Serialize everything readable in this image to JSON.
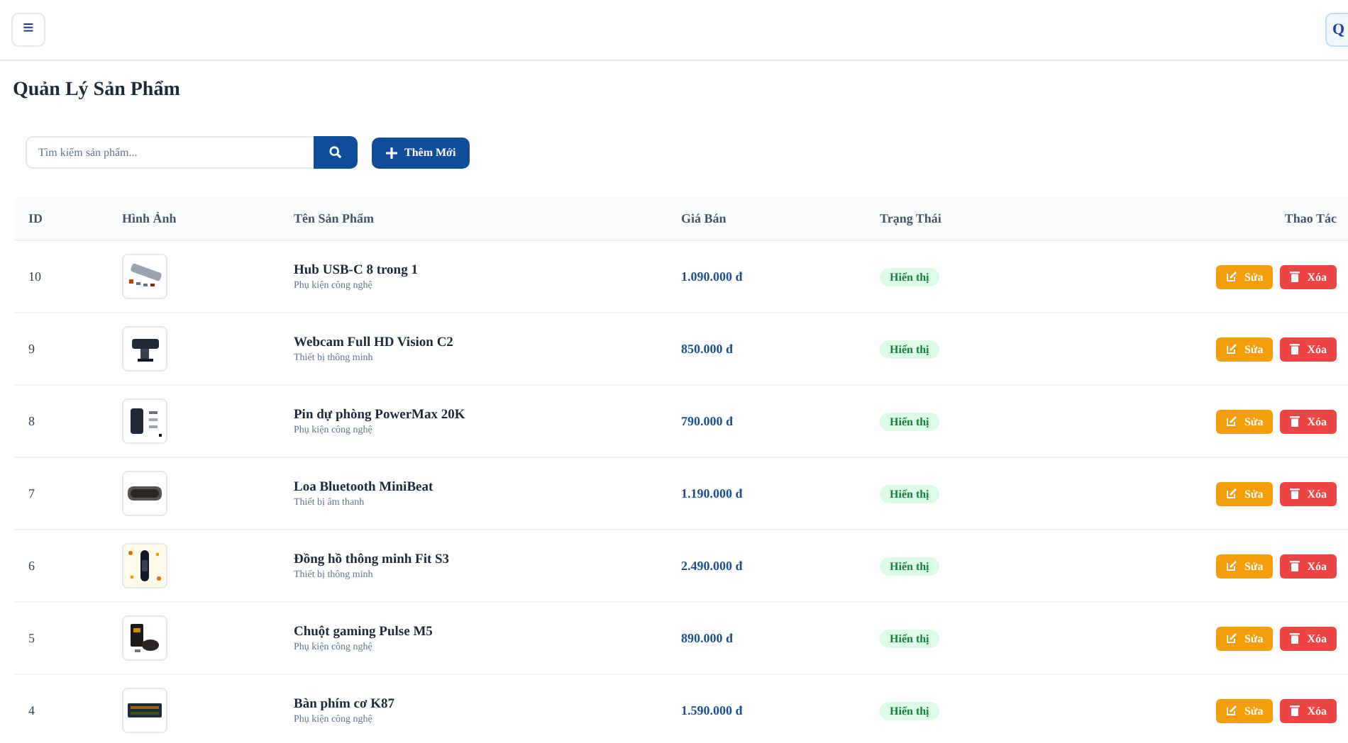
{
  "topbar": {
    "menu_icon": "≡",
    "account_button": "Q"
  },
  "page_title": "Quản Lý Sản Phẩm",
  "search": {
    "placeholder": "Tìm kiếm sản phẩm..."
  },
  "add_button": "Thêm Mới",
  "table": {
    "columns": [
      "ID",
      "Hình Ảnh",
      "Tên Sản Phẩm",
      "Giá Bán",
      "Trạng Thái",
      "Thao Tác"
    ],
    "rows": [
      {
        "id": "10",
        "name": "Hub USB-C 8 trong 1",
        "category": "Phụ kiện công nghệ",
        "price": "1.090.000 đ",
        "status": "Hiển thị",
        "edit": "Sửa",
        "delete": "Xóa"
      },
      {
        "id": "9",
        "name": "Webcam Full HD Vision C2",
        "category": "Thiết bị thông minh",
        "price": "850.000 đ",
        "status": "Hiển thị",
        "edit": "Sửa",
        "delete": "Xóa"
      },
      {
        "id": "8",
        "name": "Pin dự phòng PowerMax 20K",
        "category": "Phụ kiện công nghệ",
        "price": "790.000 đ",
        "status": "Hiển thị",
        "edit": "Sửa",
        "delete": "Xóa"
      },
      {
        "id": "7",
        "name": "Loa Bluetooth MiniBeat",
        "category": "Thiết bị âm thanh",
        "price": "1.190.000 đ",
        "status": "Hiển thị",
        "edit": "Sửa",
        "delete": "Xóa"
      },
      {
        "id": "6",
        "name": "Đồng hồ thông minh Fit S3",
        "category": "Thiết bị thông minh",
        "price": "2.490.000 đ",
        "status": "Hiển thị",
        "edit": "Sửa",
        "delete": "Xóa"
      },
      {
        "id": "5",
        "name": "Chuột gaming Pulse M5",
        "category": "Phụ kiện công nghệ",
        "price": "890.000 đ",
        "status": "Hiển thị",
        "edit": "Sửa",
        "delete": "Xóa"
      },
      {
        "id": "4",
        "name": "Bàn phím cơ K87",
        "category": "Phụ kiện công nghệ",
        "price": "1.590.000 đ",
        "status": "Hiển thị",
        "edit": "Sửa",
        "delete": "Xóa"
      }
    ]
  }
}
